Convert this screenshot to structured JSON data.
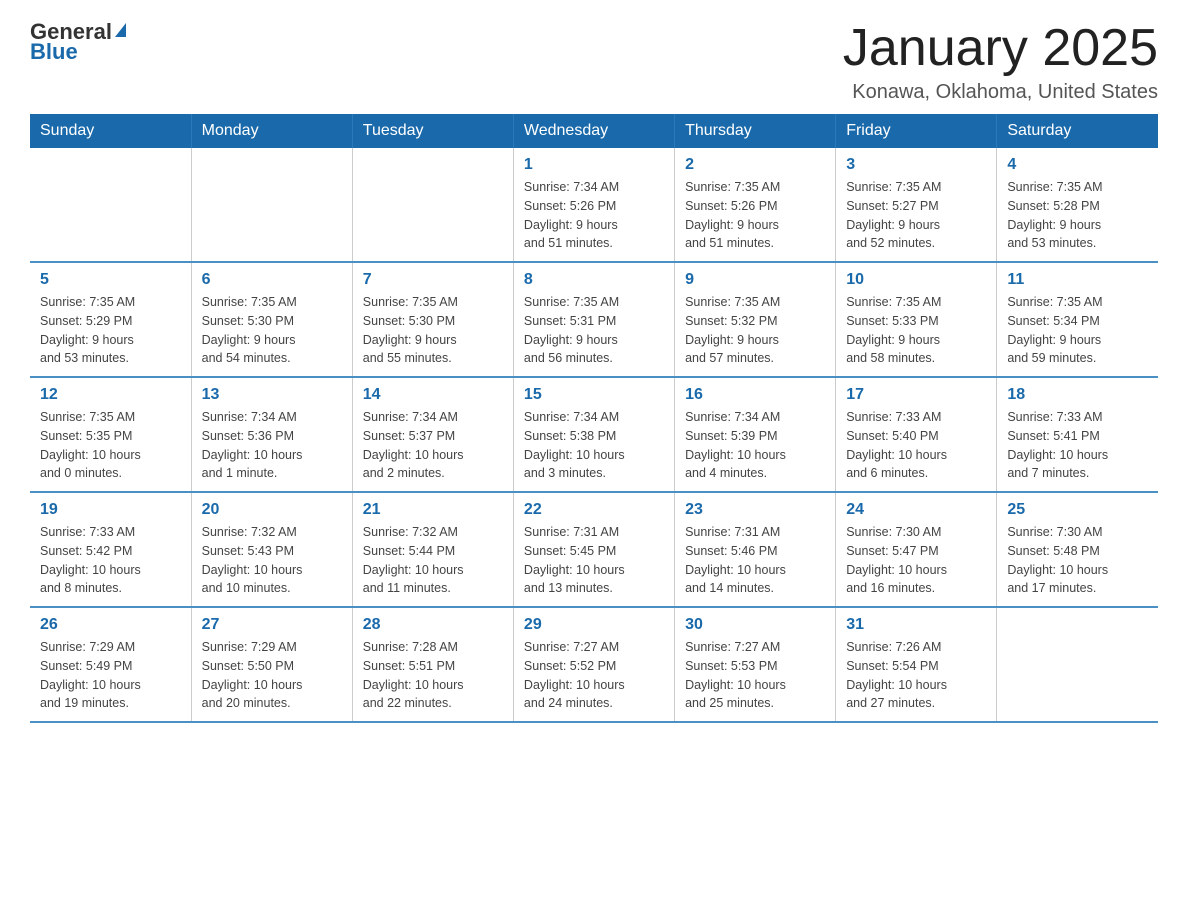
{
  "logo": {
    "text_general": "General",
    "text_blue": "Blue",
    "arrow": "▶"
  },
  "header": {
    "month_title": "January 2025",
    "location": "Konawa, Oklahoma, United States"
  },
  "weekdays": [
    "Sunday",
    "Monday",
    "Tuesday",
    "Wednesday",
    "Thursday",
    "Friday",
    "Saturday"
  ],
  "weeks": [
    [
      {
        "day": "",
        "info": ""
      },
      {
        "day": "",
        "info": ""
      },
      {
        "day": "",
        "info": ""
      },
      {
        "day": "1",
        "info": "Sunrise: 7:34 AM\nSunset: 5:26 PM\nDaylight: 9 hours\nand 51 minutes."
      },
      {
        "day": "2",
        "info": "Sunrise: 7:35 AM\nSunset: 5:26 PM\nDaylight: 9 hours\nand 51 minutes."
      },
      {
        "day": "3",
        "info": "Sunrise: 7:35 AM\nSunset: 5:27 PM\nDaylight: 9 hours\nand 52 minutes."
      },
      {
        "day": "4",
        "info": "Sunrise: 7:35 AM\nSunset: 5:28 PM\nDaylight: 9 hours\nand 53 minutes."
      }
    ],
    [
      {
        "day": "5",
        "info": "Sunrise: 7:35 AM\nSunset: 5:29 PM\nDaylight: 9 hours\nand 53 minutes."
      },
      {
        "day": "6",
        "info": "Sunrise: 7:35 AM\nSunset: 5:30 PM\nDaylight: 9 hours\nand 54 minutes."
      },
      {
        "day": "7",
        "info": "Sunrise: 7:35 AM\nSunset: 5:30 PM\nDaylight: 9 hours\nand 55 minutes."
      },
      {
        "day": "8",
        "info": "Sunrise: 7:35 AM\nSunset: 5:31 PM\nDaylight: 9 hours\nand 56 minutes."
      },
      {
        "day": "9",
        "info": "Sunrise: 7:35 AM\nSunset: 5:32 PM\nDaylight: 9 hours\nand 57 minutes."
      },
      {
        "day": "10",
        "info": "Sunrise: 7:35 AM\nSunset: 5:33 PM\nDaylight: 9 hours\nand 58 minutes."
      },
      {
        "day": "11",
        "info": "Sunrise: 7:35 AM\nSunset: 5:34 PM\nDaylight: 9 hours\nand 59 minutes."
      }
    ],
    [
      {
        "day": "12",
        "info": "Sunrise: 7:35 AM\nSunset: 5:35 PM\nDaylight: 10 hours\nand 0 minutes."
      },
      {
        "day": "13",
        "info": "Sunrise: 7:34 AM\nSunset: 5:36 PM\nDaylight: 10 hours\nand 1 minute."
      },
      {
        "day": "14",
        "info": "Sunrise: 7:34 AM\nSunset: 5:37 PM\nDaylight: 10 hours\nand 2 minutes."
      },
      {
        "day": "15",
        "info": "Sunrise: 7:34 AM\nSunset: 5:38 PM\nDaylight: 10 hours\nand 3 minutes."
      },
      {
        "day": "16",
        "info": "Sunrise: 7:34 AM\nSunset: 5:39 PM\nDaylight: 10 hours\nand 4 minutes."
      },
      {
        "day": "17",
        "info": "Sunrise: 7:33 AM\nSunset: 5:40 PM\nDaylight: 10 hours\nand 6 minutes."
      },
      {
        "day": "18",
        "info": "Sunrise: 7:33 AM\nSunset: 5:41 PM\nDaylight: 10 hours\nand 7 minutes."
      }
    ],
    [
      {
        "day": "19",
        "info": "Sunrise: 7:33 AM\nSunset: 5:42 PM\nDaylight: 10 hours\nand 8 minutes."
      },
      {
        "day": "20",
        "info": "Sunrise: 7:32 AM\nSunset: 5:43 PM\nDaylight: 10 hours\nand 10 minutes."
      },
      {
        "day": "21",
        "info": "Sunrise: 7:32 AM\nSunset: 5:44 PM\nDaylight: 10 hours\nand 11 minutes."
      },
      {
        "day": "22",
        "info": "Sunrise: 7:31 AM\nSunset: 5:45 PM\nDaylight: 10 hours\nand 13 minutes."
      },
      {
        "day": "23",
        "info": "Sunrise: 7:31 AM\nSunset: 5:46 PM\nDaylight: 10 hours\nand 14 minutes."
      },
      {
        "day": "24",
        "info": "Sunrise: 7:30 AM\nSunset: 5:47 PM\nDaylight: 10 hours\nand 16 minutes."
      },
      {
        "day": "25",
        "info": "Sunrise: 7:30 AM\nSunset: 5:48 PM\nDaylight: 10 hours\nand 17 minutes."
      }
    ],
    [
      {
        "day": "26",
        "info": "Sunrise: 7:29 AM\nSunset: 5:49 PM\nDaylight: 10 hours\nand 19 minutes."
      },
      {
        "day": "27",
        "info": "Sunrise: 7:29 AM\nSunset: 5:50 PM\nDaylight: 10 hours\nand 20 minutes."
      },
      {
        "day": "28",
        "info": "Sunrise: 7:28 AM\nSunset: 5:51 PM\nDaylight: 10 hours\nand 22 minutes."
      },
      {
        "day": "29",
        "info": "Sunrise: 7:27 AM\nSunset: 5:52 PM\nDaylight: 10 hours\nand 24 minutes."
      },
      {
        "day": "30",
        "info": "Sunrise: 7:27 AM\nSunset: 5:53 PM\nDaylight: 10 hours\nand 25 minutes."
      },
      {
        "day": "31",
        "info": "Sunrise: 7:26 AM\nSunset: 5:54 PM\nDaylight: 10 hours\nand 27 minutes."
      },
      {
        "day": "",
        "info": ""
      }
    ]
  ]
}
